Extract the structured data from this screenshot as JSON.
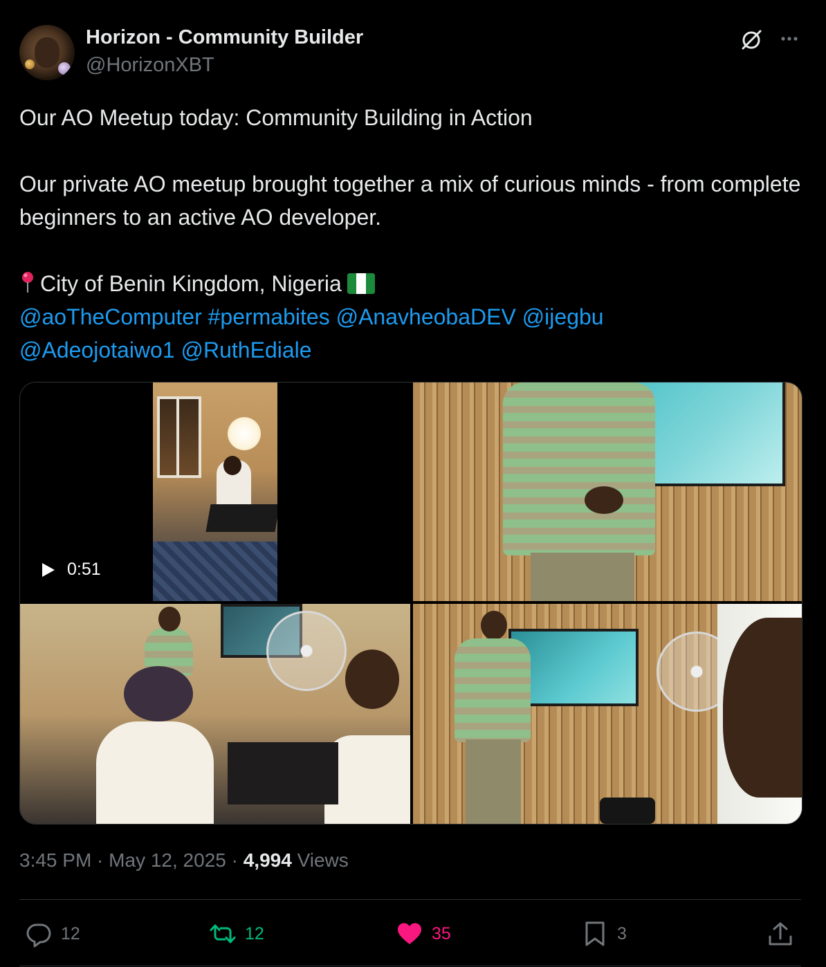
{
  "author": {
    "display_name": "Horizon - Community Builder",
    "handle": "@HorizonXBT"
  },
  "header_icons": [
    "grok-icon",
    "more-icon"
  ],
  "tweet": {
    "line1": "Our AO Meetup today: Community Building in Action",
    "line2": "Our private AO meetup brought together a mix of curious minds - from complete beginners to an active AO developer.",
    "location": "City of Benin Kingdom, Nigeria",
    "links": {
      "m1": "@aoTheComputer",
      "h1": "#permabites",
      "m2": "@AnavheobaDEV",
      "m3": "@ijegbu",
      "m4": "@Adeojotaiwo1",
      "m5": "@RuthEdiale"
    }
  },
  "media": {
    "video_duration": "0:51"
  },
  "meta": {
    "time": "3:45 PM",
    "date": "May 12, 2025",
    "views_count": "4,994",
    "views_label": "Views"
  },
  "actions": {
    "replies": "12",
    "reposts": "12",
    "likes": "35",
    "bookmarks": "3"
  },
  "colors": {
    "background": "#000000",
    "text": "#e7e9ea",
    "muted": "#71767b",
    "link": "#1d9bf0",
    "repost": "#00ba7c",
    "like": "#f91880"
  }
}
